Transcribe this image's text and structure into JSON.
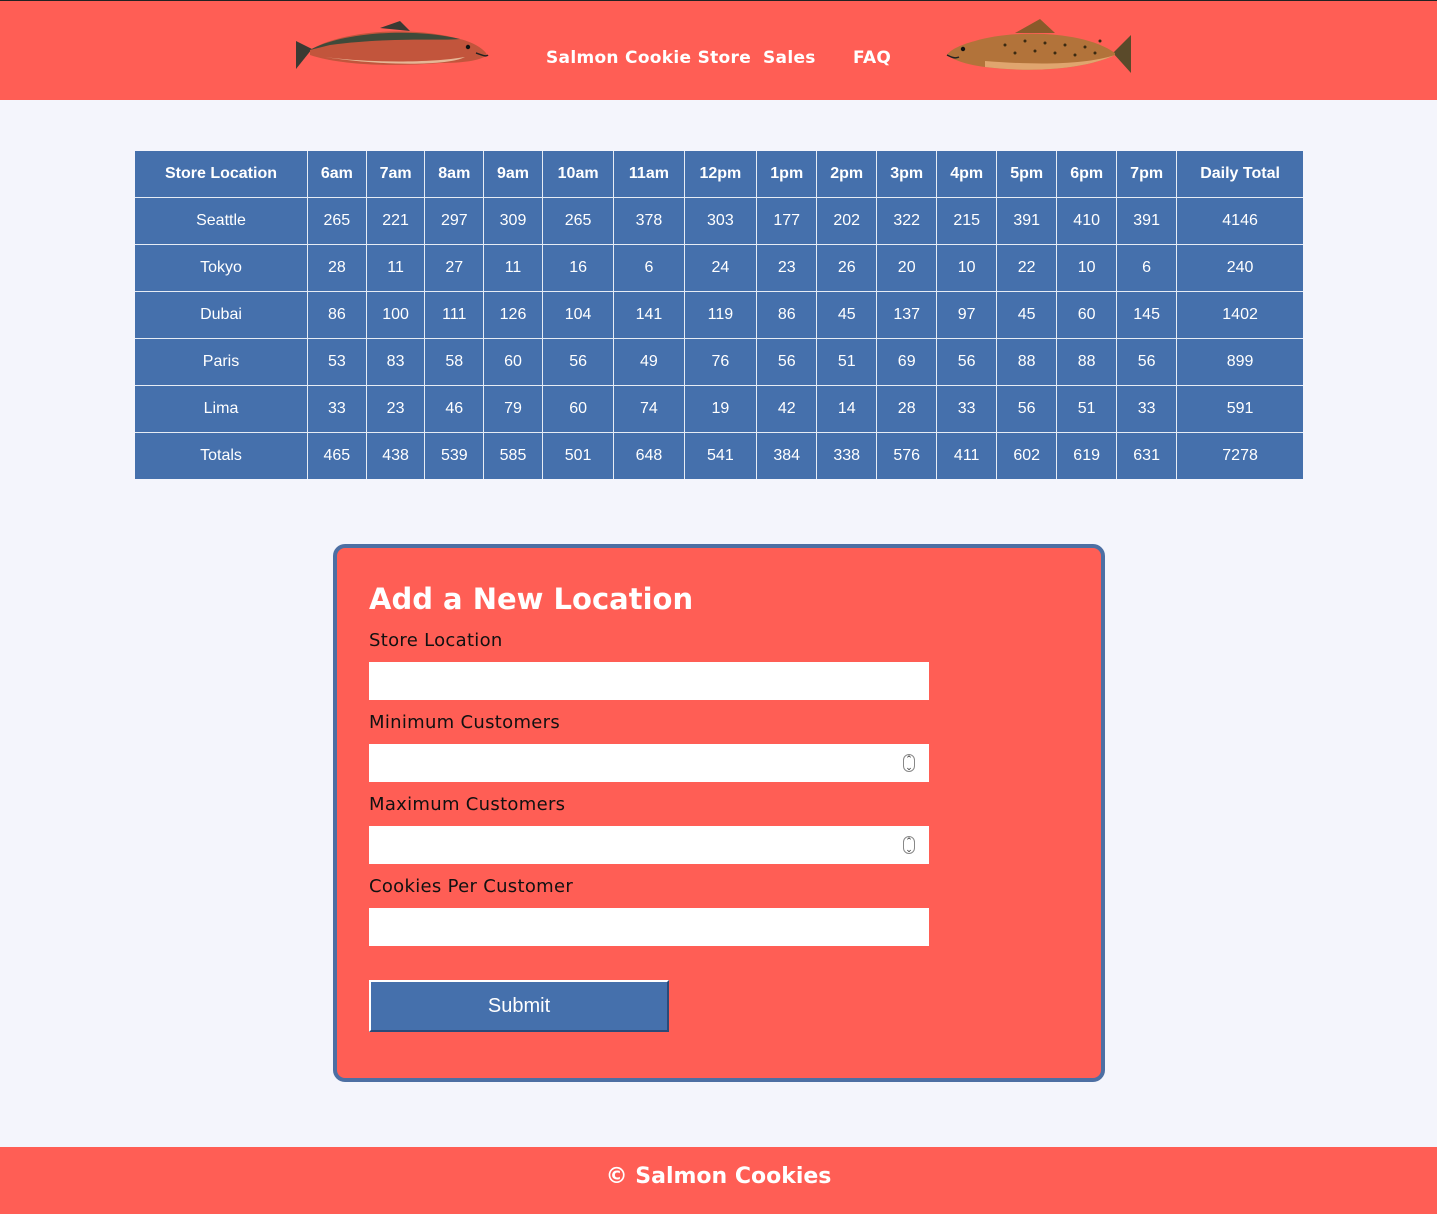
{
  "header": {
    "left_fish_icon": "salmon-fish-icon",
    "right_fish_icon": "trout-fish-icon",
    "nav": [
      {
        "label": "Salmon Cookie Store"
      },
      {
        "label": "Sales"
      },
      {
        "label": "FAQ"
      }
    ]
  },
  "colors": {
    "brand_coral": "#ff5e55",
    "table_blue": "#4570ac",
    "page_bg": "#f4f5fc"
  },
  "table": {
    "headers": [
      "Store Location",
      "6am",
      "7am",
      "8am",
      "9am",
      "10am",
      "11am",
      "12pm",
      "1pm",
      "2pm",
      "3pm",
      "4pm",
      "5pm",
      "6pm",
      "7pm",
      "Daily Total"
    ],
    "rows": [
      [
        "Seattle",
        "265",
        "221",
        "297",
        "309",
        "265",
        "378",
        "303",
        "177",
        "202",
        "322",
        "215",
        "391",
        "410",
        "391",
        "4146"
      ],
      [
        "Tokyo",
        "28",
        "11",
        "27",
        "11",
        "16",
        "6",
        "24",
        "23",
        "26",
        "20",
        "10",
        "22",
        "10",
        "6",
        "240"
      ],
      [
        "Dubai",
        "86",
        "100",
        "111",
        "126",
        "104",
        "141",
        "119",
        "86",
        "45",
        "137",
        "97",
        "45",
        "60",
        "145",
        "1402"
      ],
      [
        "Paris",
        "53",
        "83",
        "58",
        "60",
        "56",
        "49",
        "76",
        "56",
        "51",
        "69",
        "56",
        "88",
        "88",
        "56",
        "899"
      ],
      [
        "Lima",
        "33",
        "23",
        "46",
        "79",
        "60",
        "74",
        "19",
        "42",
        "14",
        "28",
        "33",
        "56",
        "51",
        "33",
        "591"
      ],
      [
        "Totals",
        "465",
        "438",
        "539",
        "585",
        "501",
        "648",
        "541",
        "384",
        "338",
        "576",
        "411",
        "602",
        "619",
        "631",
        "7278"
      ]
    ]
  },
  "form": {
    "title": "Add a New Location",
    "fields": [
      {
        "label": "Store Location",
        "value": "",
        "placeholder": ""
      },
      {
        "label": "Minimum Customers",
        "value": "",
        "placeholder": ""
      },
      {
        "label": "Maximum Customers",
        "value": "",
        "placeholder": ""
      },
      {
        "label": "Cookies Per Customer",
        "value": "",
        "placeholder": ""
      }
    ],
    "submit_label": "Submit"
  },
  "footer": {
    "text": "© Salmon Cookies"
  }
}
